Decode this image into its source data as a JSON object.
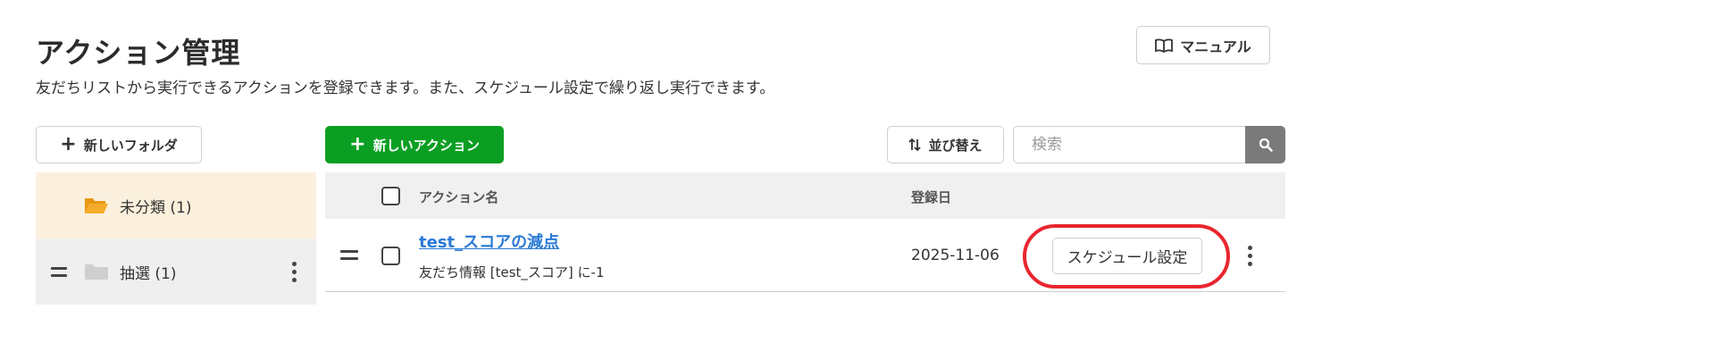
{
  "header": {
    "title": "アクション管理",
    "description": "友だちリストから実行できるアクションを登録できます。また、スケジュール設定で繰り返し実行できます。",
    "manual_label": "マニュアル"
  },
  "toolbar": {
    "new_folder_label": "新しいフォルダ",
    "new_action_label": "新しいアクション",
    "sort_label": "並び替え",
    "search_placeholder": "検索"
  },
  "folders": [
    {
      "name": "未分類 (1)",
      "selected": true
    },
    {
      "name": "抽選 (1)",
      "selected": false
    }
  ],
  "table": {
    "headers": {
      "name": "アクション名",
      "date": "登録日"
    },
    "rows": [
      {
        "name": "test_スコアの減点",
        "detail": "友だち情報 [test_スコア] に-1",
        "date": "2025-11-06",
        "schedule_label": "スケジュール設定"
      }
    ]
  },
  "colors": {
    "accent_green": "#0a9f22",
    "link_blue": "#2a7ad6",
    "highlight_red": "#e8262f",
    "folder_orange": "#f0a21a",
    "selected_bg": "#fbf0dd"
  },
  "icons": {
    "manual": "book-icon",
    "sort": "sort-arrows-icon",
    "search": "search-icon",
    "folder_open": "folder-open-icon",
    "folder": "folder-icon",
    "drag": "drag-handle-icon",
    "more": "more-vertical-icon"
  }
}
